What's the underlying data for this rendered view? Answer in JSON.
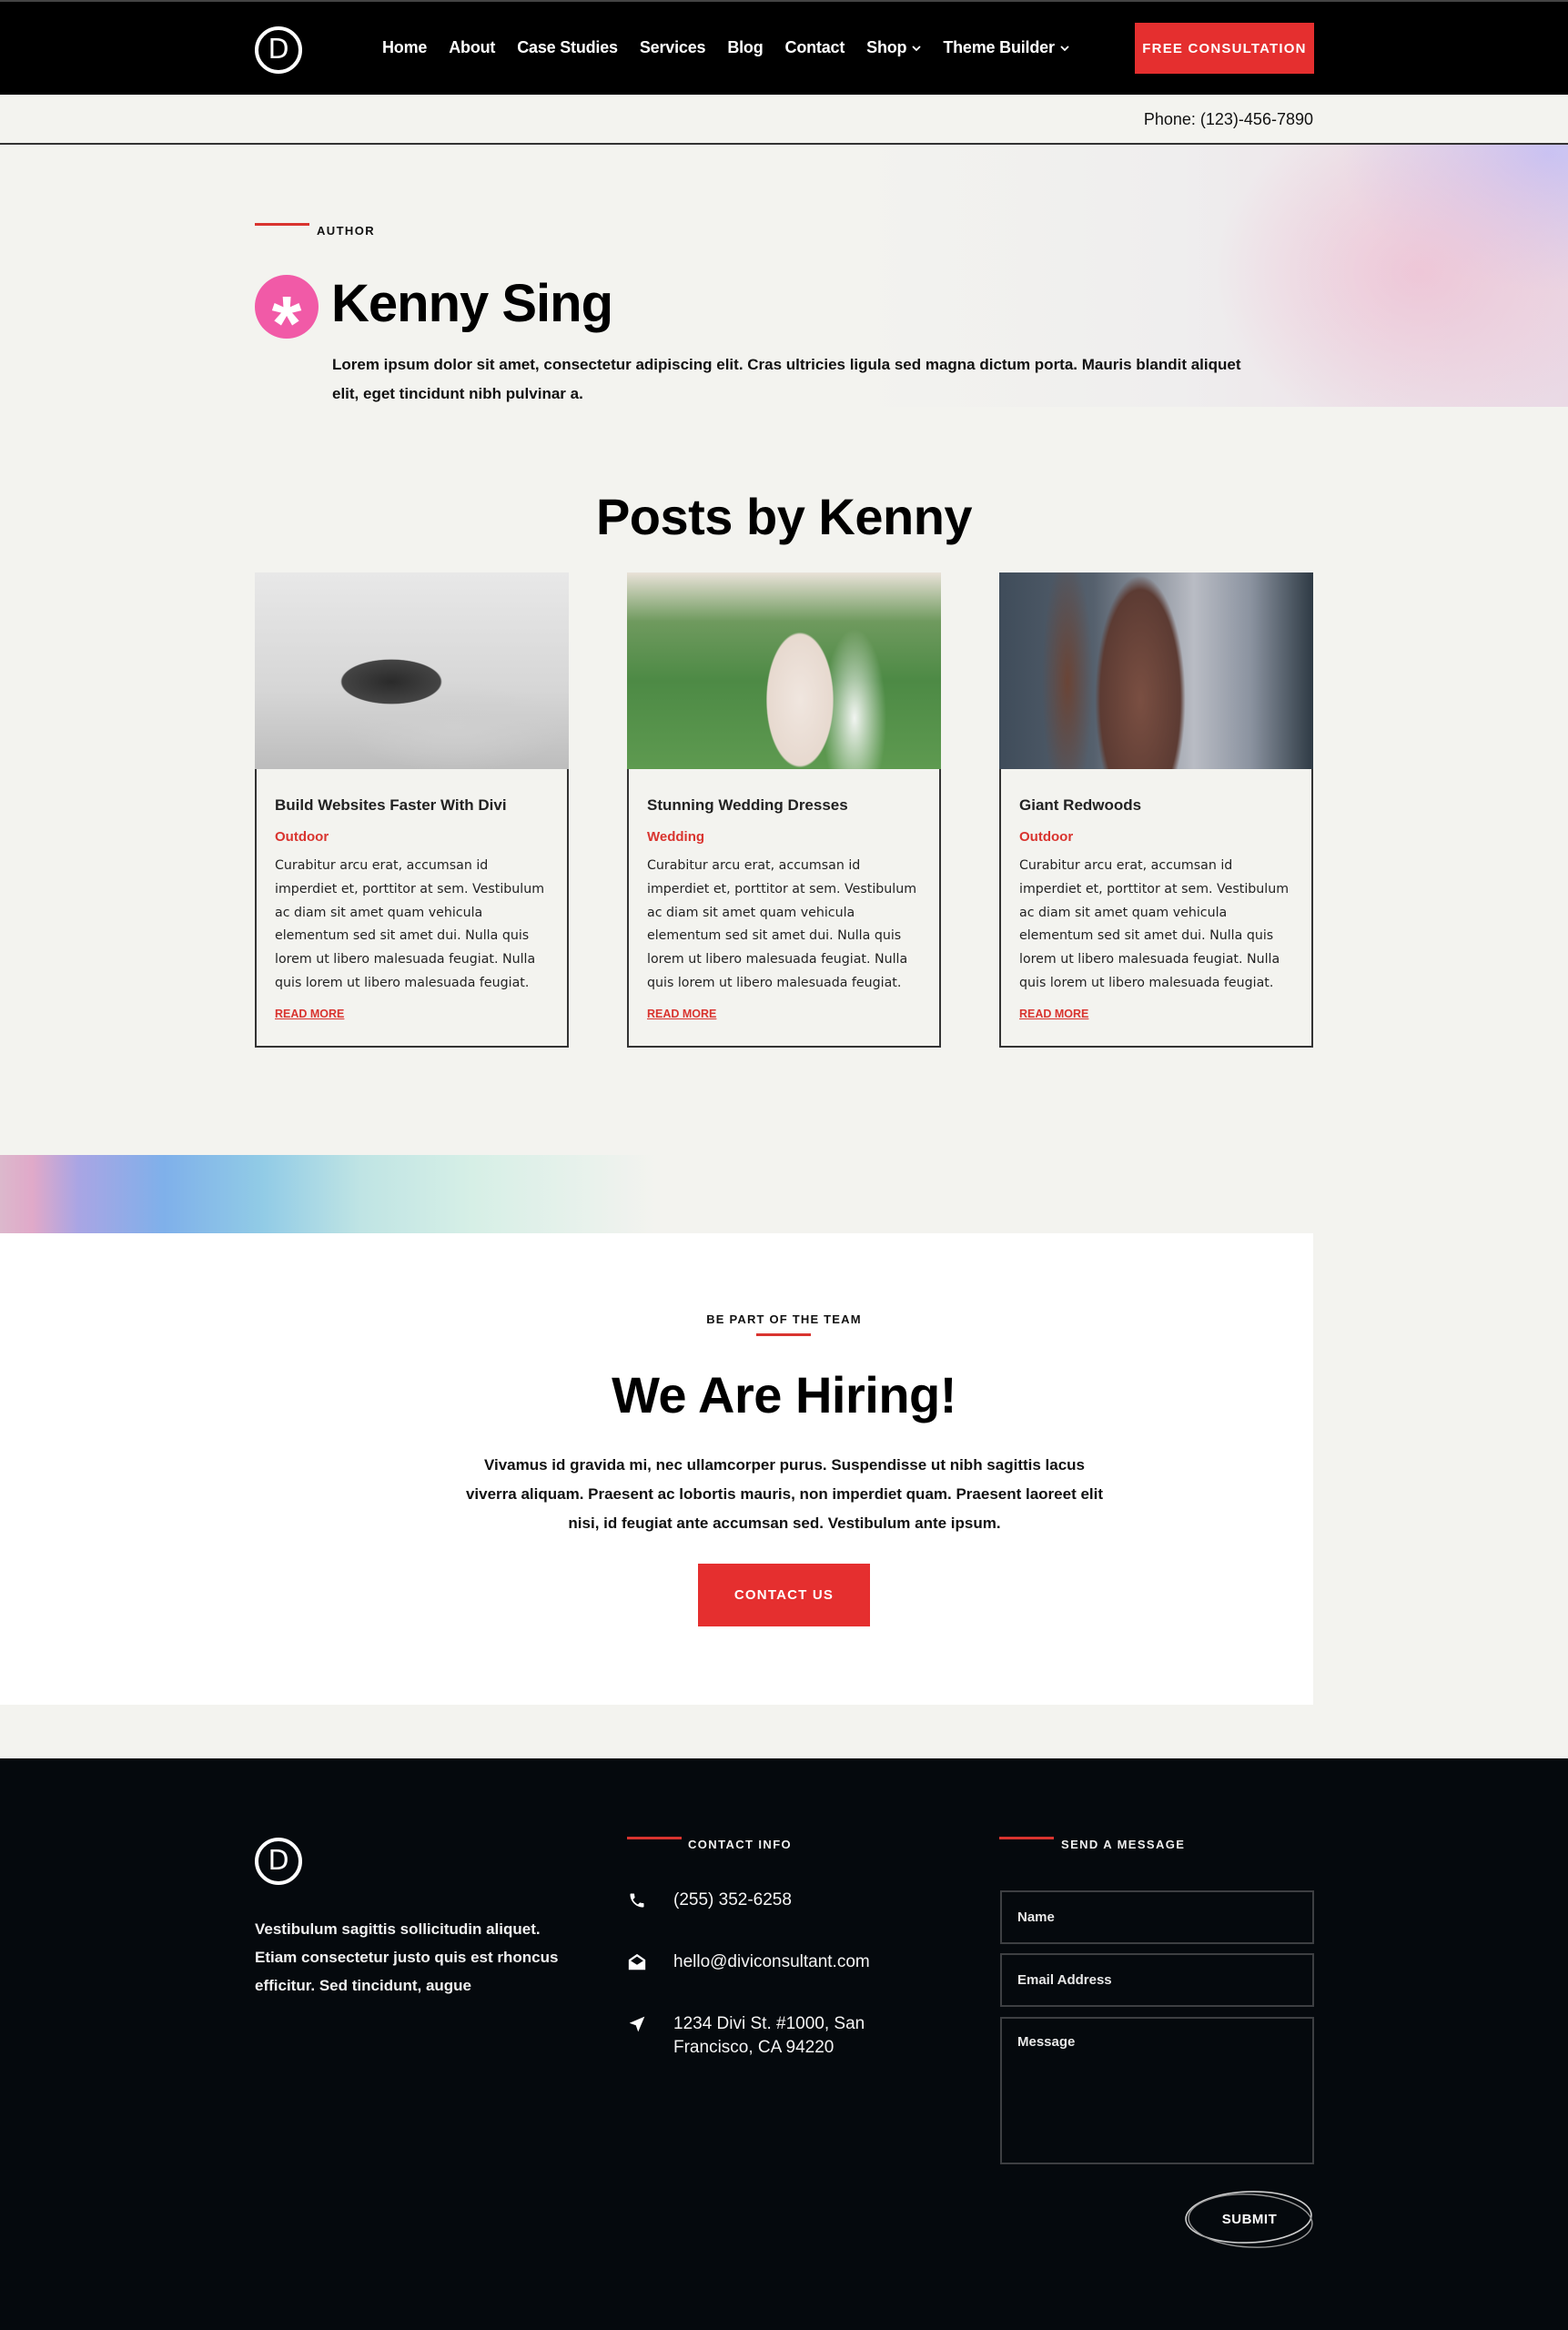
{
  "header": {
    "logo_letter": "D",
    "nav": [
      {
        "label": "Home",
        "has_dropdown": false
      },
      {
        "label": "About",
        "has_dropdown": false
      },
      {
        "label": "Case Studies",
        "has_dropdown": false
      },
      {
        "label": "Services",
        "has_dropdown": false
      },
      {
        "label": "Blog",
        "has_dropdown": false
      },
      {
        "label": "Contact",
        "has_dropdown": false
      },
      {
        "label": "Shop",
        "has_dropdown": true
      },
      {
        "label": "Theme Builder",
        "has_dropdown": true
      }
    ],
    "dropdown_glyph": "⌄",
    "cta_label": "FREE CONSULTATION",
    "phone": "Phone: (123)-456-7890"
  },
  "author": {
    "eyebrow": "AUTHOR",
    "avatar_glyph": "*",
    "name": "Kenny Sing",
    "bio": "Lorem ipsum dolor sit amet, consectetur adipiscing elit. Cras ultricies ligula sed magna dictum porta. Mauris blandit aliquet elit, eget tincidunt nibh pulvinar a."
  },
  "posts": {
    "title": "Posts by Kenny",
    "items": [
      {
        "title": "Build Websites Faster With Divi",
        "category": "Outdoor",
        "excerpt": "Curabitur arcu erat, accumsan id imperdiet et, porttitor at sem. Vestibulum ac diam sit amet quam vehicula elementum sed sit amet dui. Nulla quis lorem ut libero malesuada feugiat. Nulla quis lorem ut libero malesuada feugiat.",
        "read_more": "READ MORE",
        "image": "hands holding smartphone (grayscale)"
      },
      {
        "title": "Stunning Wedding Dresses",
        "category": "Wedding",
        "excerpt": "Curabitur arcu erat, accumsan id imperdiet et, porttitor at sem. Vestibulum ac diam sit amet quam vehicula elementum sed sit amet dui. Nulla quis lorem ut libero malesuada feugiat. Nulla quis lorem ut libero malesuada feugiat.",
        "read_more": "READ MORE",
        "image": "bride in lace dress on grass"
      },
      {
        "title": "Giant Redwoods",
        "category": "Outdoor",
        "excerpt": "Curabitur arcu erat, accumsan id imperdiet et, porttitor at sem. Vestibulum ac diam sit amet quam vehicula elementum sed sit amet dui. Nulla quis lorem ut libero malesuada feugiat. Nulla quis lorem ut libero malesuada feugiat.",
        "read_more": "READ MORE",
        "image": "redwood trunk in foggy forest"
      }
    ]
  },
  "hiring": {
    "eyebrow": "BE PART OF THE TEAM",
    "title": "We Are Hiring!",
    "body": "Vivamus id gravida mi, nec ullamcorper purus. Suspendisse ut nibh sagittis lacus viverra aliquam. Praesent ac lobortis mauris, non imperdiet quam. Praesent laoreet elit nisi, id feugiat ante accumsan sed. Vestibulum ante ipsum.",
    "cta_label": "CONTACT US"
  },
  "footer": {
    "logo_letter": "D",
    "about": "Vestibulum sagittis sollicitudin aliquet. Etiam consectetur justo quis est rhoncus efficitur. Sed tincidunt, augue",
    "contact_heading": "CONTACT INFO",
    "contacts": [
      {
        "icon": "phone-icon",
        "text": "(255) 352-6258"
      },
      {
        "icon": "envelope-open-icon",
        "text": "hello@diviconsultant.com"
      },
      {
        "icon": "location-arrow-icon",
        "text": "1234 Divi St. #1000, San Francisco, CA 94220"
      }
    ],
    "form_heading": "SEND A MESSAGE",
    "form": {
      "name_placeholder": "Name",
      "name_value": "",
      "email_placeholder": "Email Address",
      "email_value": "",
      "message_placeholder": "Message",
      "message_value": "",
      "submit_label": "SUBMIT"
    }
  },
  "colors": {
    "accent_red": "#e52f2f",
    "avatar_pink": "#f15aa7",
    "header_bg": "#000000",
    "footer_bg": "#05090d",
    "page_bg": "#f3f3ef"
  }
}
